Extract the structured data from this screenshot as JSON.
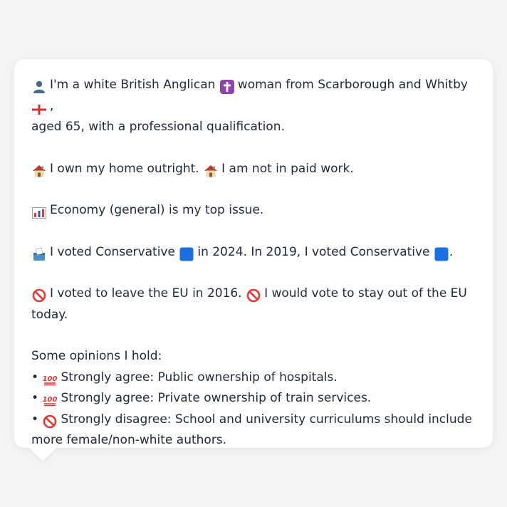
{
  "profile": {
    "intro": {
      "text_a": "I'm a white British Anglican",
      "text_b": "woman from Scarborough and Whitby",
      "text_c": ",",
      "line2": "aged 65, with a professional qualification."
    },
    "home": {
      "text_a": "I own my home outright.",
      "text_b": "I am not in paid work."
    },
    "issue": {
      "text": "Economy (general) is my top issue."
    },
    "vote": {
      "text_a": "I voted Conservative",
      "text_b": "in 2024. In 2019, I voted Conservative",
      "text_c": "."
    },
    "eu": {
      "text_a": "I voted to leave the EU in 2016.",
      "text_b": "I would vote to stay out of the EU",
      "line2": "today."
    },
    "opinions": {
      "heading": "Some opinions I hold:",
      "items": [
        {
          "bullet": "•",
          "text": "Strongly agree: Public ownership of hospitals."
        },
        {
          "bullet": "•",
          "text": "Strongly agree: Private ownership of train services."
        },
        {
          "bullet": "•",
          "text": "Strongly disagree: School and university curriculums should include",
          "line2": "more female/non-white authors."
        }
      ]
    },
    "icons": {
      "person": "person-icon",
      "cross": "latin-cross-icon",
      "flag": "england-flag-icon",
      "house": "house-icon",
      "chart": "chart-icon",
      "ballot": "ballot-box-icon",
      "party": "blue-square-icon",
      "prohibited": "prohibited-icon",
      "hundred": "hundred-points-icon"
    },
    "colors": {
      "conservative": "#1d6fe0",
      "prohibited": "#e53935",
      "hundred": "#e53935",
      "cross_bg": "#8e44ad"
    }
  }
}
